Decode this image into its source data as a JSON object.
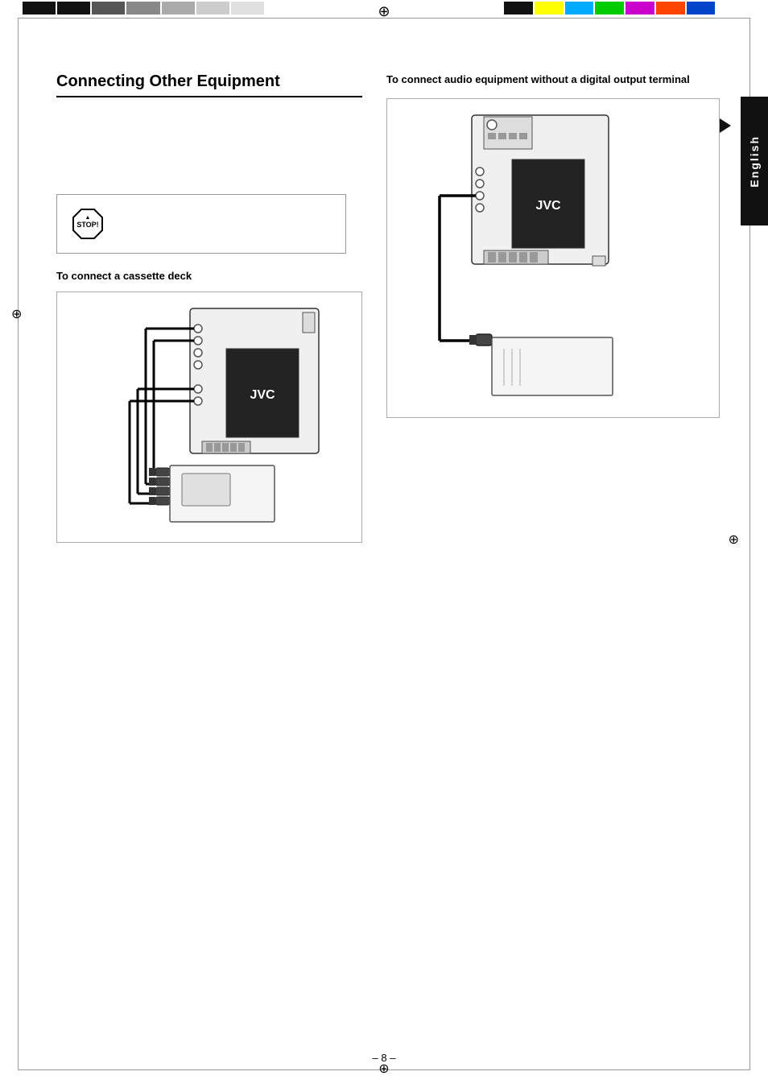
{
  "page": {
    "number": "– 8 –",
    "language_tab": "English"
  },
  "header": {
    "cross_symbol": "⊕"
  },
  "section": {
    "title": "Connecting Other Equipment",
    "stop_description": "",
    "cassette_subheading": "To connect a cassette deck",
    "audio_subheading": "To connect audio equipment without a digital output terminal"
  },
  "top_bar_left": [
    {
      "class": ""
    },
    {
      "class": ""
    },
    {
      "class": "light1"
    },
    {
      "class": "light2"
    },
    {
      "class": "light3"
    },
    {
      "class": "light4"
    },
    {
      "class": "light5"
    }
  ],
  "top_bar_colors": [
    "#000000",
    "#ffff00",
    "#00aaff",
    "#00cc00",
    "#cc00cc",
    "#ff4400",
    "#0000cc",
    "#ffffff"
  ]
}
